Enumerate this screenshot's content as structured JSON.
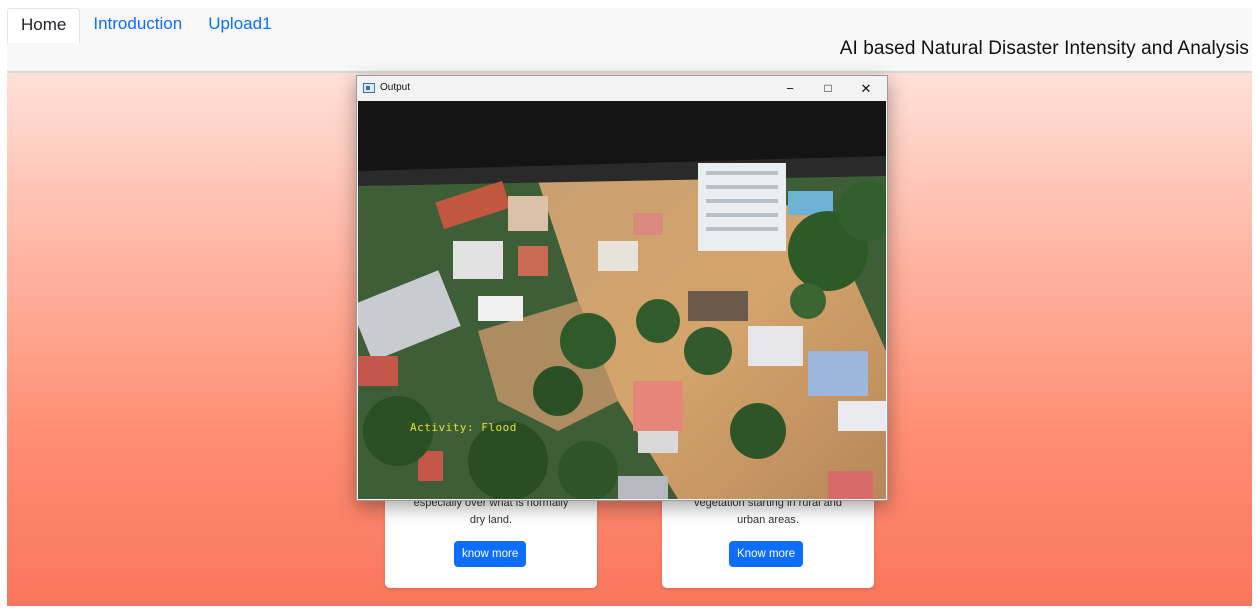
{
  "navbar": {
    "tabs": [
      {
        "label": "Home",
        "active": true
      },
      {
        "label": "Introduction",
        "active": false
      },
      {
        "label": "Upload1",
        "active": false
      }
    ],
    "brand": "AI based Natural Disaster Intensity and Analysis"
  },
  "cards": [
    {
      "text_line1": "especially over what is normally",
      "text_line2": "dry land.",
      "button": "know more"
    },
    {
      "text_line1": "vegetation starting in rural and",
      "text_line2": "urban areas.",
      "button": "Know more"
    }
  ],
  "output_window": {
    "title": "Output",
    "controls": {
      "minimize": "−",
      "maximize": "□",
      "close": "✕"
    },
    "overlay_text": "Activity: Flood"
  },
  "colors": {
    "link": "#0d6efd",
    "button": "#0d6efd",
    "overlay": "#e8e02a"
  }
}
